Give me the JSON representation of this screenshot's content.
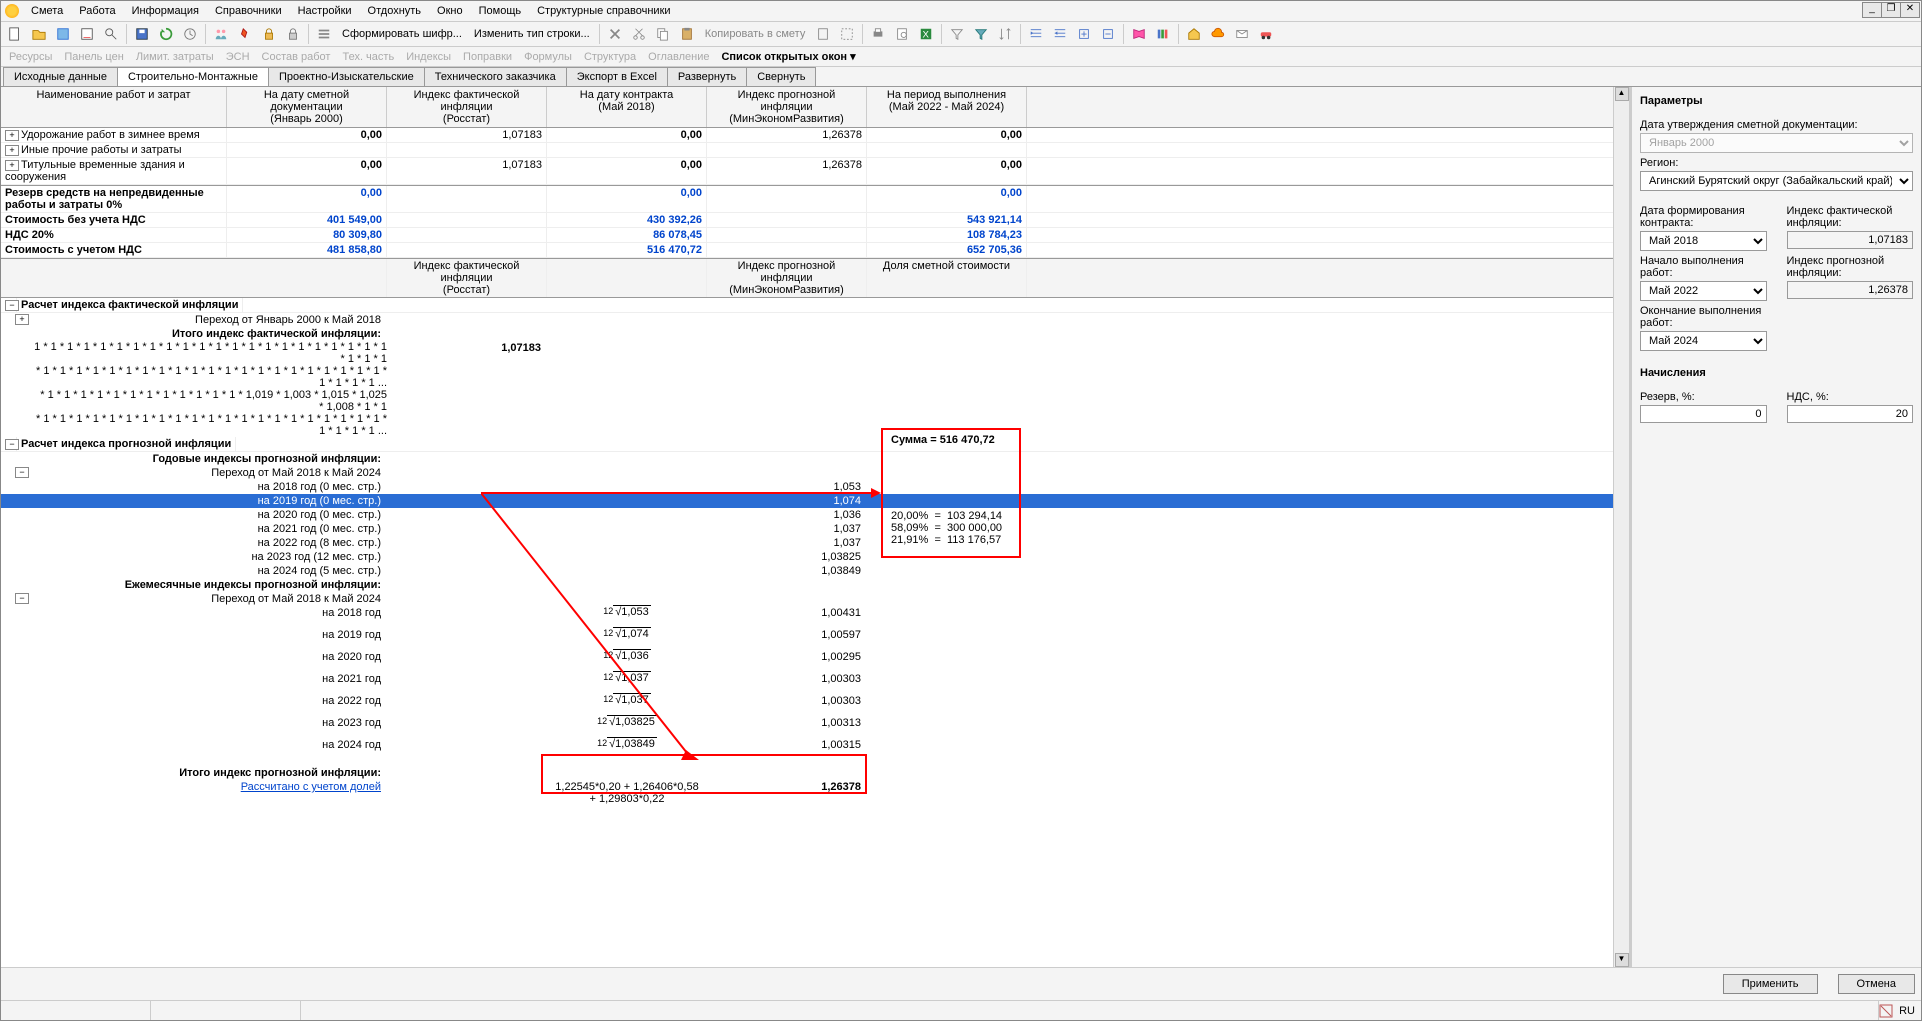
{
  "win": {
    "min": "_",
    "rest": "❐",
    "close": "✕"
  },
  "menu": [
    "Смета",
    "Работа",
    "Информация",
    "Справочники",
    "Настройки",
    "Отдохнуть",
    "Окно",
    "Помощь",
    "Структурные справочники"
  ],
  "toolbar_text": {
    "form_cipher": "Сформировать шифр...",
    "change_type": "Изменить тип строки...",
    "copy_to_estimate": "Копировать в смету"
  },
  "disabled_bar": [
    "Ресурсы",
    "Панель цен",
    "Лимит. затраты",
    "ЭСН",
    "Состав работ",
    "Тех. часть",
    "Индексы",
    "Поправки",
    "Формулы",
    "Структура",
    "Оглавление"
  ],
  "open_windows": "Список открытых окон ▾",
  "tabs": [
    "Исходные данные",
    "Строительно-Монтажные",
    "Проектно-Изыскательские",
    "Технического заказчика",
    "Экспорт в Excel",
    "Развернуть",
    "Свернуть"
  ],
  "headers": {
    "h1": "Наименование работ и затрат",
    "h2a": "На дату сметной документации",
    "h2b": "(Январь 2000)",
    "h3a": "Индекс фактической инфляции",
    "h3b": "(Росстат)",
    "h4a": "На дату контракта",
    "h4b": "(Май 2018)",
    "h5a": "Индекс прогнозной инфляции",
    "h5b": "(МинЭкономРазвития)",
    "h6a": "На период выполнения",
    "h6b": "(Май 2022 - Май 2024)"
  },
  "rows": [
    {
      "name": "Удорожание работ в зимнее время",
      "v2": "0,00",
      "v3": "1,07183",
      "v4": "0,00",
      "v5": "1,26378",
      "v6": "0,00"
    },
    {
      "name": "Иные прочие работы и затраты"
    },
    {
      "name": "Титульные временные здания и сооружения",
      "v2": "0,00",
      "v3": "1,07183",
      "v4": "0,00",
      "v5": "1,26378",
      "v6": "0,00"
    }
  ],
  "reserve": {
    "name": "Резерв средств на непредвиденные работы и затраты 0%",
    "v2": "0,00",
    "v4": "0,00",
    "v6": "0,00"
  },
  "totals": [
    {
      "name": "Стоимость без учета НДС",
      "v2": "401 549,00",
      "v4": "430 392,26",
      "v6": "543 921,14"
    },
    {
      "name": "НДС 20%",
      "v2": "80 309,80",
      "v4": "86 078,45",
      "v6": "108 784,23"
    },
    {
      "name": "Стоимость с учетом НДС",
      "v2": "481 858,80",
      "v4": "516 470,72",
      "v6": "652 705,36"
    }
  ],
  "sec2": {
    "h3a": "Индекс фактической инфляции",
    "h3b": "(Росстат)",
    "h5a": "Индекс прогнозной инфляции",
    "h5b": "(МинЭкономРазвития)",
    "h6": "Доля сметной стоимости"
  },
  "calc_fact": {
    "title": "Расчет индекса фактической инфляции",
    "transition": "Переход от Январь 2000 к Май 2018",
    "itogo": "Итого индекс фактической инфляции:",
    "formula1": "1 * 1 * 1 * 1 * 1 * 1 * 1 * 1 * 1 * 1 * 1 * 1 * 1 * 1 * 1 * 1 * 1 * 1 * 1 * 1 * 1 * 1 * 1 * 1 * 1",
    "formula2": "* 1 * 1 * 1 * 1 * 1 * 1 * 1 * 1 * 1 * 1 * 1 * 1 * 1 * 1 * 1 * 1 * 1 * 1 * 1 * 1 * 1 * 1 * 1 * 1 * 1 ...",
    "formula3": "* 1 * 1 * 1 * 1 * 1 * 1 * 1 * 1 * 1 * 1 * 1 * 1 * 1,019 * 1,003 * 1,015 * 1,025 * 1,008 * 1 * 1",
    "formula4": "* 1 * 1 * 1 * 1 * 1 * 1 * 1 * 1 * 1 * 1 * 1 * 1 * 1 * 1 * 1 * 1 * 1 * 1 * 1 * 1 * 1 * 1 * 1 * 1 * 1 ...",
    "result": "1,07183"
  },
  "calc_prog": {
    "title": "Расчет индекса прогнозной инфляции",
    "yearly_header": "Годовые индексы прогнозной инфляции:",
    "transition": "Переход от Май 2018 к Май 2024",
    "years": [
      {
        "label": "на 2018 год (0 мес. стр.)",
        "v": "1,053"
      },
      {
        "label": "на 2019 год (0 мес. стр.)",
        "v": "1,074",
        "sel": true
      },
      {
        "label": "на 2020 год (0 мес. стр.)",
        "v": "1,036"
      },
      {
        "label": "на 2021 год (0 мес. стр.)",
        "v": "1,037"
      },
      {
        "label": "на 2022 год (8 мес. стр.)",
        "v": "1,037"
      },
      {
        "label": "на 2023 год (12 мес. стр.)",
        "v": "1,03825"
      },
      {
        "label": "на 2024 год (5 мес. стр.)",
        "v": "1,03849"
      }
    ],
    "monthly_header": "Ежемесячные индексы прогнозной инфляции:",
    "transition2": "Переход от Май 2018 к Май 2024",
    "monthly": [
      {
        "label": "на 2018 год",
        "root": "1,053",
        "v": "1,00431"
      },
      {
        "label": "на 2019 год",
        "root": "1,074",
        "v": "1,00597"
      },
      {
        "label": "на 2020 год",
        "root": "1,036",
        "v": "1,00295"
      },
      {
        "label": "на 2021 год",
        "root": "1,037",
        "v": "1,00303"
      },
      {
        "label": "на 2022 год",
        "root": "1,037",
        "v": "1,00303"
      },
      {
        "label": "на 2023 год",
        "root": "1,03825",
        "v": "1,00313"
      },
      {
        "label": "на 2024 год",
        "root": "1,03849",
        "v": "1,00315"
      }
    ],
    "itogo": "Итого индекс прогнозной инфляции:",
    "calc_link": "Рассчитано с учетом долей",
    "final_formula": "1,22545*0,20 + 1,26406*0,58 + 1,29803*0,22",
    "final": "1,26378"
  },
  "anno": {
    "sum_label": "Сумма = 516 470,72",
    "rows": [
      {
        "pct": "20,00%",
        "eq": "=",
        "val": "103 294,14"
      },
      {
        "pct": "58,09%",
        "eq": "=",
        "val": "300 000,00"
      },
      {
        "pct": "21,91%",
        "eq": "=",
        "val": "113 176,57"
      }
    ]
  },
  "side": {
    "title": "Параметры",
    "date_approve_label": "Дата утверждения сметной документации:",
    "date_approve": "Январь 2000",
    "region_label": "Регион:",
    "region": "Агинский Бурятский округ (Забайкальский край)",
    "contract_date_label": "Дата формирования контракта:",
    "contract_date": "Май 2018",
    "fact_idx_label": "Индекс фактической инфляции:",
    "fact_idx": "1,07183",
    "start_label": "Начало выполнения работ:",
    "start": "Май 2022",
    "prog_idx_label": "Индекс прогнозной инфляции:",
    "prog_idx": "1,26378",
    "end_label": "Окончание выполнения работ:",
    "end": "Май 2024",
    "accruals": "Начисления",
    "reserve_label": "Резерв, %:",
    "reserve": "0",
    "vat_label": "НДС, %:",
    "vat": "20",
    "apply": "Применить",
    "cancel": "Отмена"
  },
  "status": {
    "ru": "RU"
  }
}
